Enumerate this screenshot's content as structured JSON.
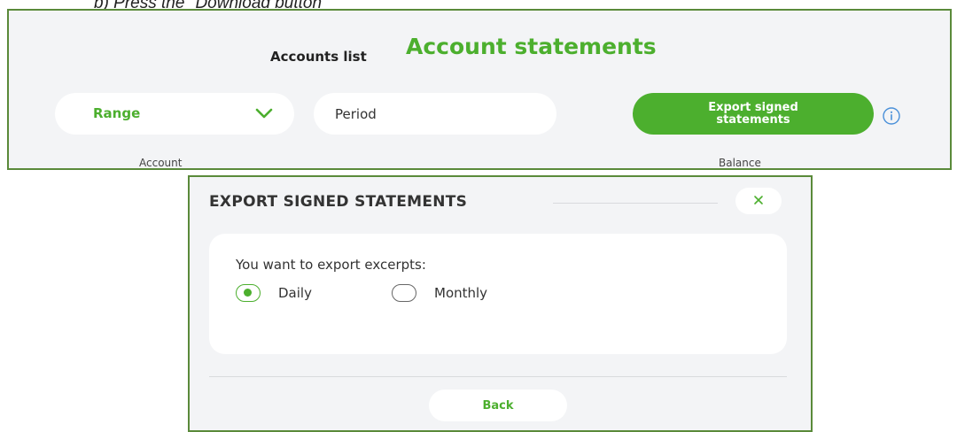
{
  "document": {
    "caption": "b)  Press the \"Download button\""
  },
  "header": {
    "tab_accounts_list": "Accounts list",
    "tab_account_statements": "Account statements"
  },
  "filters": {
    "range_label": "Range",
    "period_placeholder": "Period",
    "export_button_label": "Export signed statements"
  },
  "table": {
    "columns": [
      "Account",
      "Balance"
    ]
  },
  "modal": {
    "title": "EXPORT SIGNED STATEMENTS",
    "question": "You want to export excerpts:",
    "options": [
      {
        "label": "Daily",
        "selected": true
      },
      {
        "label": "Monthly",
        "selected": false
      }
    ],
    "back_label": "Back"
  },
  "colors": {
    "accent": "#4caf2e",
    "panel_background": "#f3f4f6",
    "frame_border": "#5a8a3a"
  },
  "icons": {
    "dropdown": "chevron-down-icon",
    "info": "info-icon",
    "close": "close-icon"
  }
}
